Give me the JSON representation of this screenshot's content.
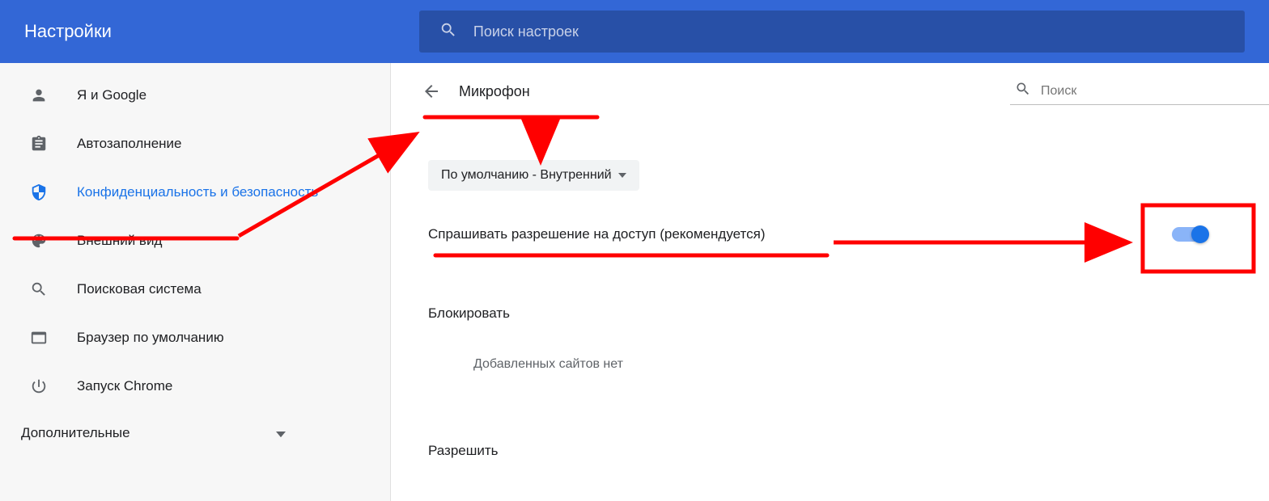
{
  "header": {
    "title": "Настройки",
    "search_placeholder": "Поиск настроек"
  },
  "sidebar": {
    "items": [
      {
        "label": "Я и Google",
        "icon": "person-icon"
      },
      {
        "label": "Автозаполнение",
        "icon": "clipboard-icon"
      },
      {
        "label": "Конфиденциальность и безопасность",
        "icon": "shield-icon",
        "active": true
      },
      {
        "label": "Внешний вид",
        "icon": "palette-icon"
      },
      {
        "label": "Поисковая система",
        "icon": "search-icon"
      },
      {
        "label": "Браузер по умолчанию",
        "icon": "browser-icon"
      },
      {
        "label": "Запуск Chrome",
        "icon": "power-icon"
      }
    ],
    "advanced_label": "Дополнительные"
  },
  "main": {
    "page_title": "Микрофон",
    "inline_search_placeholder": "Поиск",
    "device_dropdown": "По умолчанию - Внутренний",
    "ask_permission_label": "Спрашивать разрешение на доступ (рекомендуется)",
    "section_block": "Блокировать",
    "section_block_empty": "Добавленных сайтов нет",
    "section_allow": "Разрешить"
  },
  "annotation_color": "#ff0000"
}
